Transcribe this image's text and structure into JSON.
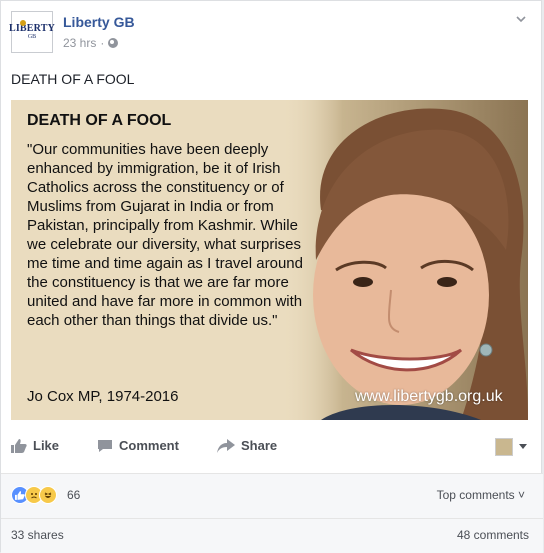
{
  "post": {
    "page_name": "Liberty GB",
    "avatar_text": "LIBERTY",
    "avatar_sub": "GB",
    "time": "23 hrs",
    "text": "DEATH OF A FOOL"
  },
  "image": {
    "title": "DEATH OF A FOOL",
    "quote": "\"Our communities have been deeply enhanced by immigration, be it of Irish Catholics across the constituency or of Muslims from Gujarat in India or from Pakistan, principally from Kashmir. While we celebrate our diversity, what surprises me time and time again as I travel around the constituency is that we are far more united and have far more in common with each other than things that divide us.\"",
    "author": "Jo Cox MP, 1974-2016",
    "url": "www.libertygb.org.uk"
  },
  "actions": {
    "like": "Like",
    "comment": "Comment",
    "share": "Share"
  },
  "reactions": {
    "count": "66",
    "sort": "Top comments ˅"
  },
  "footer": {
    "shares": "33 shares",
    "comments": "48 comments"
  },
  "colors": {
    "link": "#365899",
    "meta": "#90949c",
    "image_bg": "#eadcbf"
  }
}
